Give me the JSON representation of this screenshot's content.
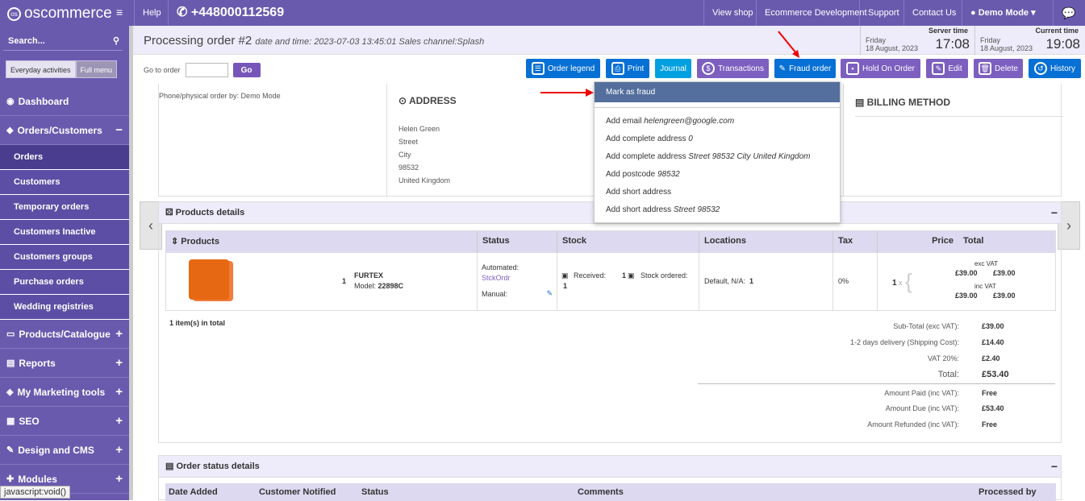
{
  "topbar": {
    "logo": "oscommerce",
    "help": "Help",
    "phone": "+448000112569",
    "view_shop": "View shop",
    "ecom_dev": "Ecommerce Development",
    "support": "Support",
    "contact": "Contact Us",
    "user": "Demo Mode"
  },
  "sidebar": {
    "search_label": "Search...",
    "tab_everyday": "Everyday activities",
    "tab_full": "Full menu",
    "menu": [
      {
        "label": "Dashboard"
      },
      {
        "label": "Orders/Customers"
      },
      {
        "label": "Orders"
      },
      {
        "label": "Customers"
      },
      {
        "label": "Temporary orders"
      },
      {
        "label": "Customers Inactive"
      },
      {
        "label": "Customers groups"
      },
      {
        "label": "Purchase orders"
      },
      {
        "label": "Wedding registries"
      },
      {
        "label": "Products/Catalogue"
      },
      {
        "label": "Reports"
      },
      {
        "label": "My Marketing tools"
      },
      {
        "label": "SEO"
      },
      {
        "label": "Design and CMS"
      },
      {
        "label": "Modules"
      }
    ]
  },
  "status_bar": "javascript:void()",
  "header": {
    "title": "Processing order #2",
    "meta": "date and time: 2023-07-03 13:45:01  Sales channel:Splash",
    "server": {
      "label": "Server time",
      "day": "Friday",
      "date": "18 August, 2023",
      "time": "17:08"
    },
    "current": {
      "label": "Current time",
      "day": "Friday",
      "date": "18 August, 2023",
      "time": "19:08"
    }
  },
  "toolbar": {
    "goto_label": "Go to order",
    "go": "Go",
    "order_legend": "Order legend",
    "print": "Print",
    "journal": "Journal",
    "transactions": "Transactions",
    "fraud": "Fraud order",
    "hold": "Hold On Order",
    "edit": "Edit",
    "delete": "Delete",
    "history": "History"
  },
  "dropdown": {
    "head": "Mark as fraud",
    "items": [
      {
        "label": "Add email ",
        "value": "helengreen@google.com"
      },
      {
        "label": "Add complete address ",
        "value": "0"
      },
      {
        "label": "Add complete address ",
        "value": "Street 98532 City United Kingdom"
      },
      {
        "label": "Add postcode ",
        "value": "98532"
      },
      {
        "label": "Add short address",
        "value": ""
      },
      {
        "label": "Add short address ",
        "value": "Street 98532"
      }
    ]
  },
  "order_info": {
    "phone_order": "Phone/physical order by: Demo Mode",
    "address_title": "ADDRESS",
    "address": [
      "Helen Green",
      "Street",
      "City",
      "98532",
      "United Kingdom"
    ],
    "billing_title": "BILLING METHOD"
  },
  "products": {
    "panel_title": "Products details",
    "headers": [
      "Products",
      "Status",
      "Stock",
      "Locations",
      "Tax",
      "Price",
      "Total"
    ],
    "row": {
      "qty": "1",
      "name": "FURTEX",
      "model_label": "Model:",
      "model": "22898C",
      "status_auto": "Automated:",
      "status_auto_val": "StckOrdr",
      "status_manual": "Manual:",
      "received_label": "Received:",
      "received_val": "1",
      "ordered_val": "1",
      "ordered_label": "Stock ordered:",
      "location": "Default, N/A:",
      "location_val": "1",
      "tax": "0%",
      "price_qty": "1",
      "exc_label": "exc VAT",
      "exc_price": "£39.00",
      "exc_total": "£39.00",
      "inc_label": "inc VAT",
      "inc_price": "£39.00",
      "inc_total": "£39.00"
    },
    "count": "1 item(s) in total",
    "totals": [
      {
        "label": "Sub-Total (exc VAT):",
        "value": "£39.00"
      },
      {
        "label": "1-2 days delivery  (Shipping Cost):",
        "value": "£14.40"
      },
      {
        "label": "VAT 20%:",
        "value": "£2.40"
      },
      {
        "label": "Total:",
        "value": "£53.40"
      },
      {
        "label": "Amount Paid (inc VAT):",
        "value": "Free"
      },
      {
        "label": "Amount Due (inc VAT):",
        "value": "£53.40"
      },
      {
        "label": "Amount Refunded (inc VAT):",
        "value": "Free"
      }
    ]
  },
  "status_details": {
    "title": "Order status details",
    "headers": [
      "Date Added",
      "Customer Notified",
      "Status",
      "Comments",
      "Processed by"
    ]
  }
}
